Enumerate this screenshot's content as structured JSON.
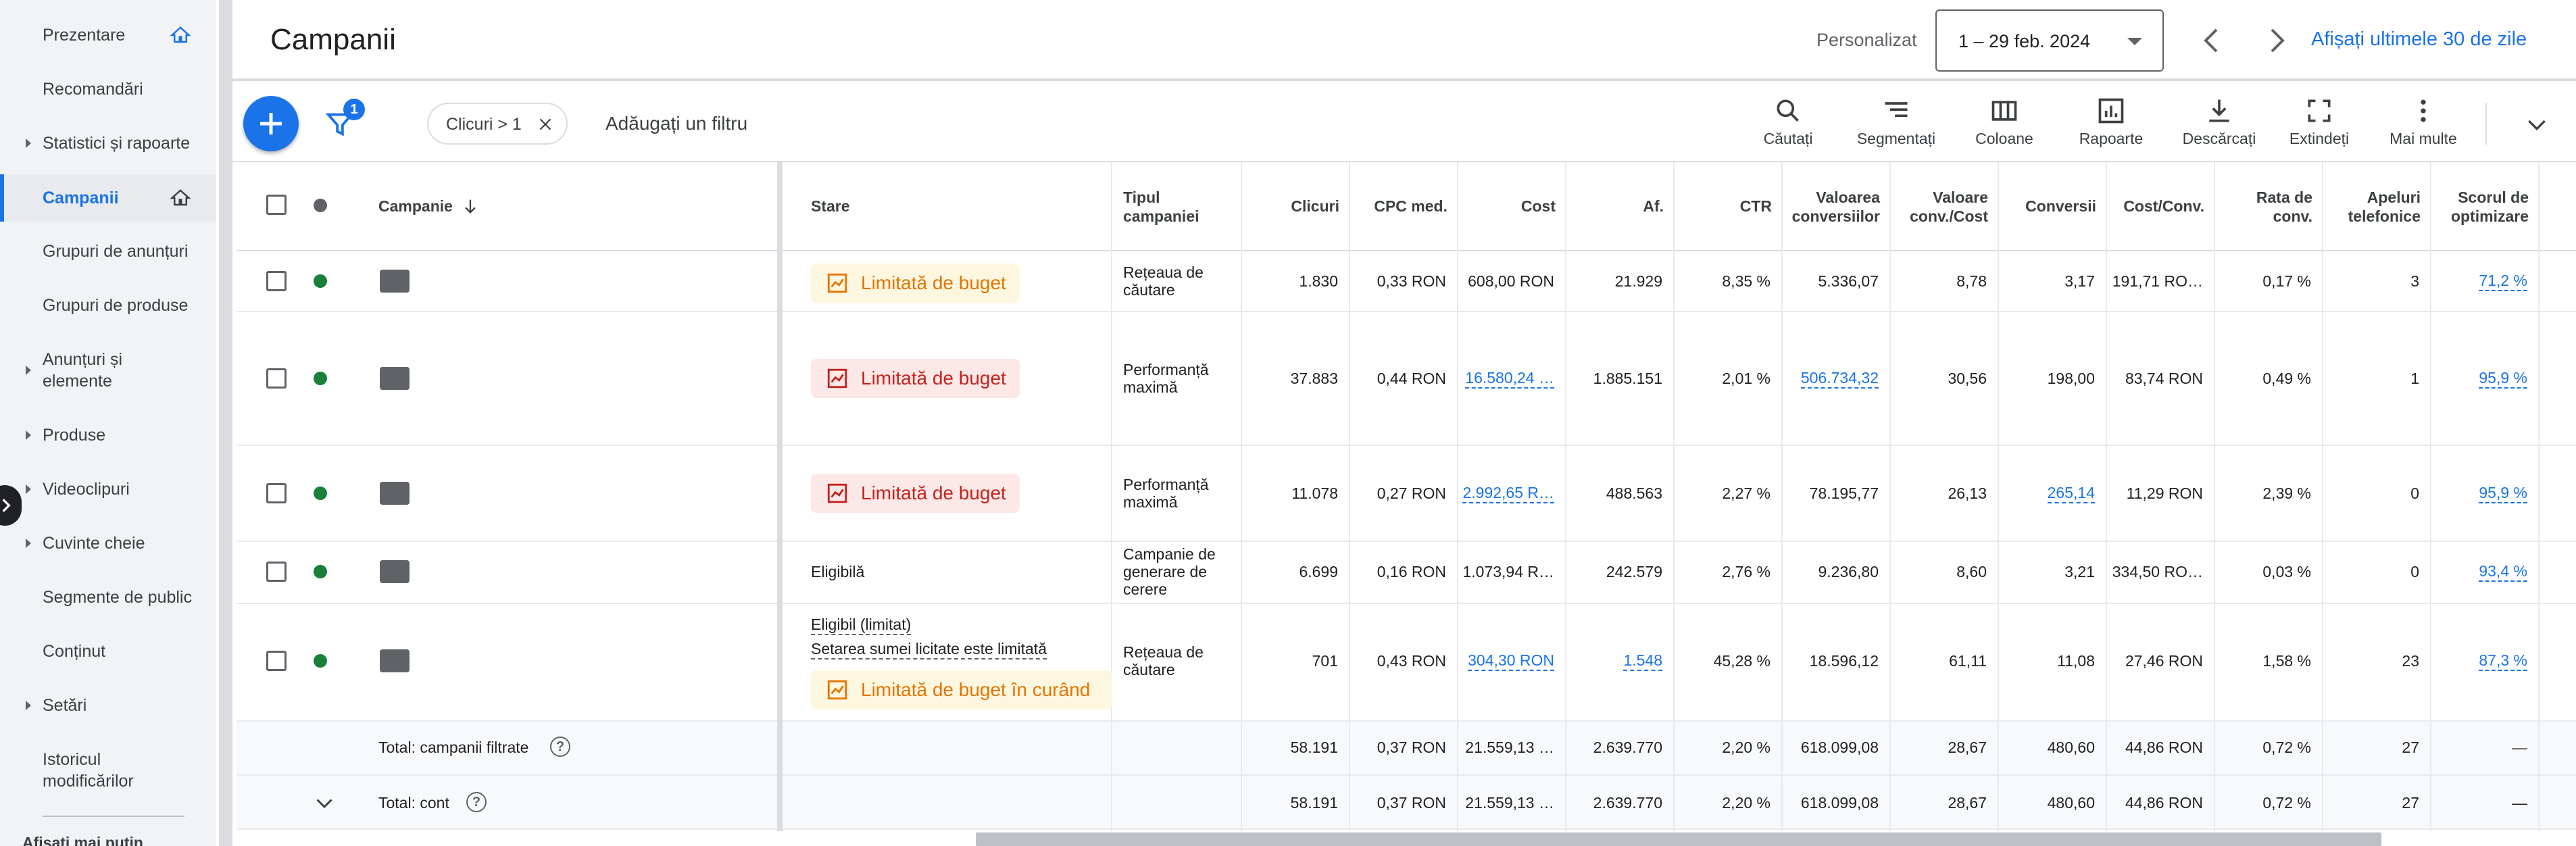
{
  "sidebar": {
    "items": [
      {
        "label": "Prezentare",
        "arrow": false,
        "home": true,
        "active": false
      },
      {
        "label": "Recomandări",
        "arrow": false,
        "home": false,
        "active": false
      },
      {
        "label": "Statistici și rapoarte",
        "arrow": true,
        "home": false,
        "active": false
      },
      {
        "label": "Campanii",
        "arrow": false,
        "home": true,
        "active": true
      },
      {
        "label": "Grupuri de anunțuri",
        "arrow": false,
        "home": false,
        "active": false
      },
      {
        "label": "Grupuri de produse",
        "arrow": false,
        "home": false,
        "active": false
      },
      {
        "label": "Anunțuri și elemente",
        "arrow": true,
        "home": false,
        "active": false
      },
      {
        "label": "Produse",
        "arrow": true,
        "home": false,
        "active": false
      },
      {
        "label": "Videoclipuri",
        "arrow": true,
        "home": false,
        "active": false
      },
      {
        "label": "Cuvinte cheie",
        "arrow": true,
        "home": false,
        "active": false
      },
      {
        "label": "Segmente de public",
        "arrow": false,
        "home": false,
        "active": false
      },
      {
        "label": "Conținut",
        "arrow": false,
        "home": false,
        "active": false
      },
      {
        "label": "Setări",
        "arrow": true,
        "home": false,
        "active": false
      },
      {
        "label": "Istoricul modificărilor",
        "arrow": false,
        "home": false,
        "active": false
      }
    ],
    "more": "Afișați mai puțin"
  },
  "header": {
    "title": "Campanii",
    "custom_label": "Personalizat",
    "date_range": "1 – 29 feb. 2024",
    "last30": "Afișați ultimele 30 de zile"
  },
  "toolbar": {
    "filter_count": "1",
    "chip_label": "Clicuri > 1",
    "add_filter": "Adăugați un filtru",
    "tools": [
      {
        "label": "Căutați",
        "icon": "search-icon"
      },
      {
        "label": "Segmentați",
        "icon": "segment-icon"
      },
      {
        "label": "Coloane",
        "icon": "columns-icon"
      },
      {
        "label": "Rapoarte",
        "icon": "reports-icon"
      },
      {
        "label": "Descărcați",
        "icon": "download-icon"
      },
      {
        "label": "Extindeți",
        "icon": "fullscreen-icon"
      },
      {
        "label": "Mai multe",
        "icon": "more-vert-icon"
      }
    ]
  },
  "table": {
    "headers": {
      "campaign": "Campanie",
      "status": "Stare",
      "type": "Tipul campaniei",
      "clicks": "Clicuri",
      "cpc": "CPC med.",
      "cost": "Cost",
      "impr": "Af.",
      "ctr": "CTR",
      "conv_value": "Valoarea conversiilor",
      "conv_value_cost": "Valoare conv./Cost",
      "conversions": "Conversii",
      "cost_conv": "Cost/Conv.",
      "conv_rate": "Rata de conv.",
      "calls": "Apeluri telefonice",
      "opt_score": "Scorul de optimizare"
    },
    "rows": [
      {
        "status": "Limitată de buget",
        "status_color": "orange",
        "type": "Rețeaua de căutare",
        "clicks": "1.830",
        "cpc": "0,33 RON",
        "cost": "608,00 RON",
        "impr": "21.929",
        "ctr": "8,35 %",
        "conv_value": "5.336,07",
        "conv_value_cost": "8,78",
        "conversions": "3,17",
        "cost_conv": "191,71 RO…",
        "conv_rate": "0,17 %",
        "calls": "3",
        "opt_score": "71,2 %"
      },
      {
        "status": "Limitată de buget",
        "status_color": "red",
        "type": "Performanță maximă",
        "clicks": "37.883",
        "cpc": "0,44 RON",
        "cost": "16.580,24 …",
        "impr": "1.885.151",
        "ctr": "2,01 %",
        "conv_value": "506.734,32",
        "conv_value_cost": "30,56",
        "conversions": "198,00",
        "cost_conv": "83,74 RON",
        "conv_rate": "0,49 %",
        "calls": "1",
        "opt_score": "95,9 %"
      },
      {
        "status": "Limitată de buget",
        "status_color": "red",
        "type": "Performanță maximă",
        "clicks": "11.078",
        "cpc": "0,27 RON",
        "cost": "2.992,65 R…",
        "impr": "488.563",
        "ctr": "2,27 %",
        "conv_value": "78.195,77",
        "conv_value_cost": "26,13",
        "conversions": "265,14",
        "cost_conv": "11,29 RON",
        "conv_rate": "2,39 %",
        "calls": "0",
        "opt_score": "95,9 %"
      },
      {
        "status": "Eligibilă",
        "type": "Campanie de generare de cerere",
        "clicks": "6.699",
        "cpc": "0,16 RON",
        "cost": "1.073,94 R…",
        "impr": "242.579",
        "ctr": "2,76 %",
        "conv_value": "9.236,80",
        "conv_value_cost": "8,60",
        "conversions": "3,21",
        "cost_conv": "334,50 RO…",
        "conv_rate": "0,03 %",
        "calls": "0",
        "opt_score": "93,4 %"
      },
      {
        "status_line1": "Eligibil (limitat)",
        "status_line2": "Setarea sumei licitate este limitată",
        "status": "Limitată de buget în curând",
        "status_color": "orange",
        "type": "Rețeaua de căutare",
        "clicks": "701",
        "cpc": "0,43 RON",
        "cost": "304,30 RON",
        "impr": "1.548",
        "ctr": "45,28 %",
        "conv_value": "18.596,12",
        "conv_value_cost": "61,11",
        "conversions": "11,08",
        "cost_conv": "27,46 RON",
        "conv_rate": "1,58 %",
        "calls": "23",
        "opt_score": "87,3 %"
      }
    ],
    "totals": [
      {
        "label": "Total: campanii filtrate",
        "clicks": "58.191",
        "cpc": "0,37 RON",
        "cost": "21.559,13 …",
        "impr": "2.639.770",
        "ctr": "2,20 %",
        "conv_value": "618.099,08",
        "conv_value_cost": "28,67",
        "conversions": "480,60",
        "cost_conv": "44,86 RON",
        "conv_rate": "0,72 %",
        "calls": "27",
        "opt_score": "—"
      },
      {
        "label": "Total: cont",
        "clicks": "58.191",
        "cpc": "0,37 RON",
        "cost": "21.559,13 …",
        "impr": "2.639.770",
        "ctr": "2,20 %",
        "conv_value": "618.099,08",
        "conv_value_cost": "28,67",
        "conversions": "480,60",
        "cost_conv": "44,86 RON",
        "conv_rate": "0,72 %",
        "calls": "27",
        "opt_score": "—"
      }
    ]
  }
}
